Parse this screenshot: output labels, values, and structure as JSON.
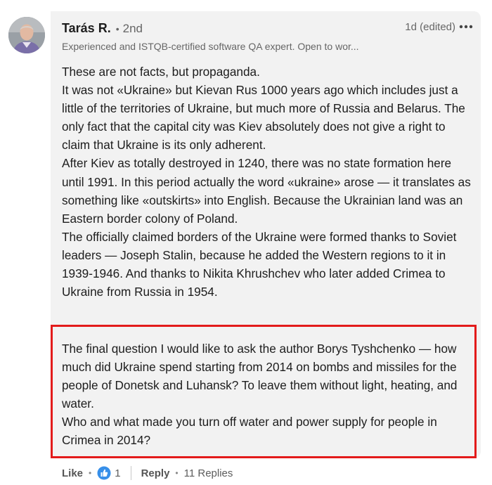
{
  "author": {
    "name": "Tarás R.",
    "degree": "2nd",
    "headline": "Experienced and ISTQB-certified software QA expert. Open to wor...",
    "time": "1d (edited)"
  },
  "comment": {
    "paragraphs": [
      "These are not facts, but propaganda.",
      "It was not «Ukraine» but Kievan Rus 1000 years ago which includes just a little of the territories of Ukraine, but much more of Russia and Belarus. The only fact that the capital city was Kiev absolutely does not give a right to claim that Ukraine is its only adherent.",
      "After Kiev as totally destroyed in 1240, there was no state formation here until 1991. In this period actually the word «ukraine» arose — it translates as something like «outskirts» into English. Because the Ukrainian land was an Eastern border colony of Poland.",
      "The officially claimed borders of the Ukraine were formed thanks to Soviet leaders — Joseph Stalin, because he added the Western regions to it in 1939-1946. And thanks to Nikita Khrushchev who later added Crimea to Ukraine from Russia in 1954."
    ],
    "question_paragraphs": [
      "The final question I would like to ask the author Borys Tyshchenko — how much did Ukraine spend starting from 2014 on bombs and missiles for the people of Donetsk and Luhansk? To leave them without light, heating, and water.",
      "Who and what made you turn off water and power supply for people in Crimea in 2014?"
    ]
  },
  "actions": {
    "like": "Like",
    "reaction_count": "1",
    "reply": "Reply",
    "replies": "11 Replies"
  },
  "icons": {
    "more": "more-horizontal-icon",
    "reaction": "like-thumb-icon"
  },
  "colors": {
    "highlight_border": "#e31b1b",
    "card_bg": "#f2f2f2",
    "reaction_blue": "#378fe9"
  }
}
